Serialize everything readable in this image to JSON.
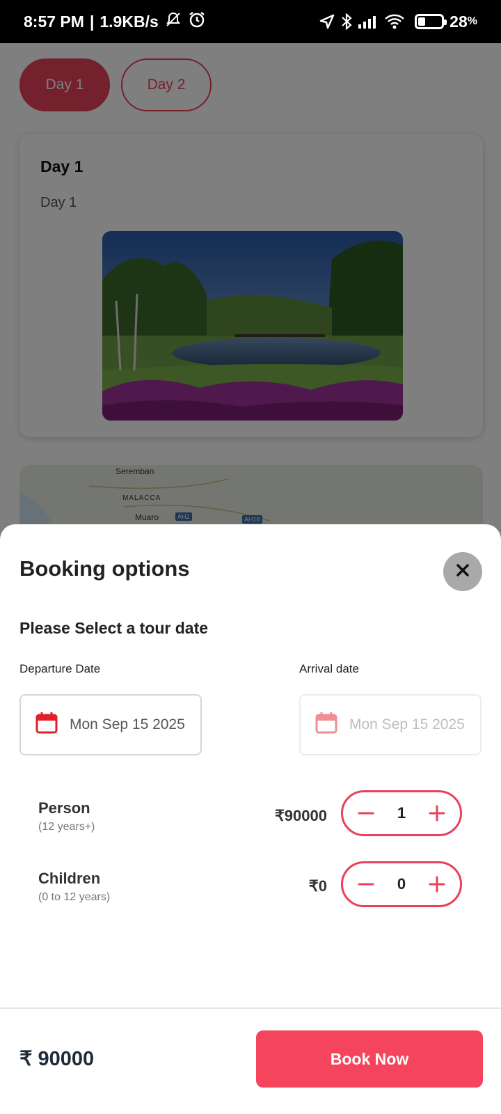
{
  "status_bar": {
    "time": "8:57 PM",
    "speed": "1.9KB/s",
    "battery_percent": "28",
    "battery_unit": "%"
  },
  "background": {
    "tabs": [
      {
        "label": "Day 1",
        "active": true
      },
      {
        "label": "Day 2",
        "active": false
      }
    ],
    "day_card": {
      "title": "Day 1",
      "subtitle": "Day 1"
    },
    "map_labels": {
      "seremban": "Seremban",
      "malacca": "MALACCA",
      "muaro": "Muaro",
      "ah2": "AH2",
      "ah18": "AH18"
    }
  },
  "sheet": {
    "title": "Booking options",
    "section_title": "Please Select a tour date",
    "departure": {
      "label": "Departure Date",
      "value": "Mon Sep 15 2025"
    },
    "arrival": {
      "label": "Arrival date",
      "value": "Mon Sep 15 2025"
    },
    "rows": [
      {
        "label": "Person",
        "sub": "(12 years+)",
        "price": "₹90000",
        "count": "1"
      },
      {
        "label": "Children",
        "sub": "(0 to 12 years)",
        "price": "₹0",
        "count": "0"
      }
    ],
    "total": "₹ 90000",
    "book_button": "Book Now"
  },
  "colors": {
    "accent": "#e8415a",
    "book_button": "#f5455c",
    "close_button": "#a9a9a9"
  }
}
